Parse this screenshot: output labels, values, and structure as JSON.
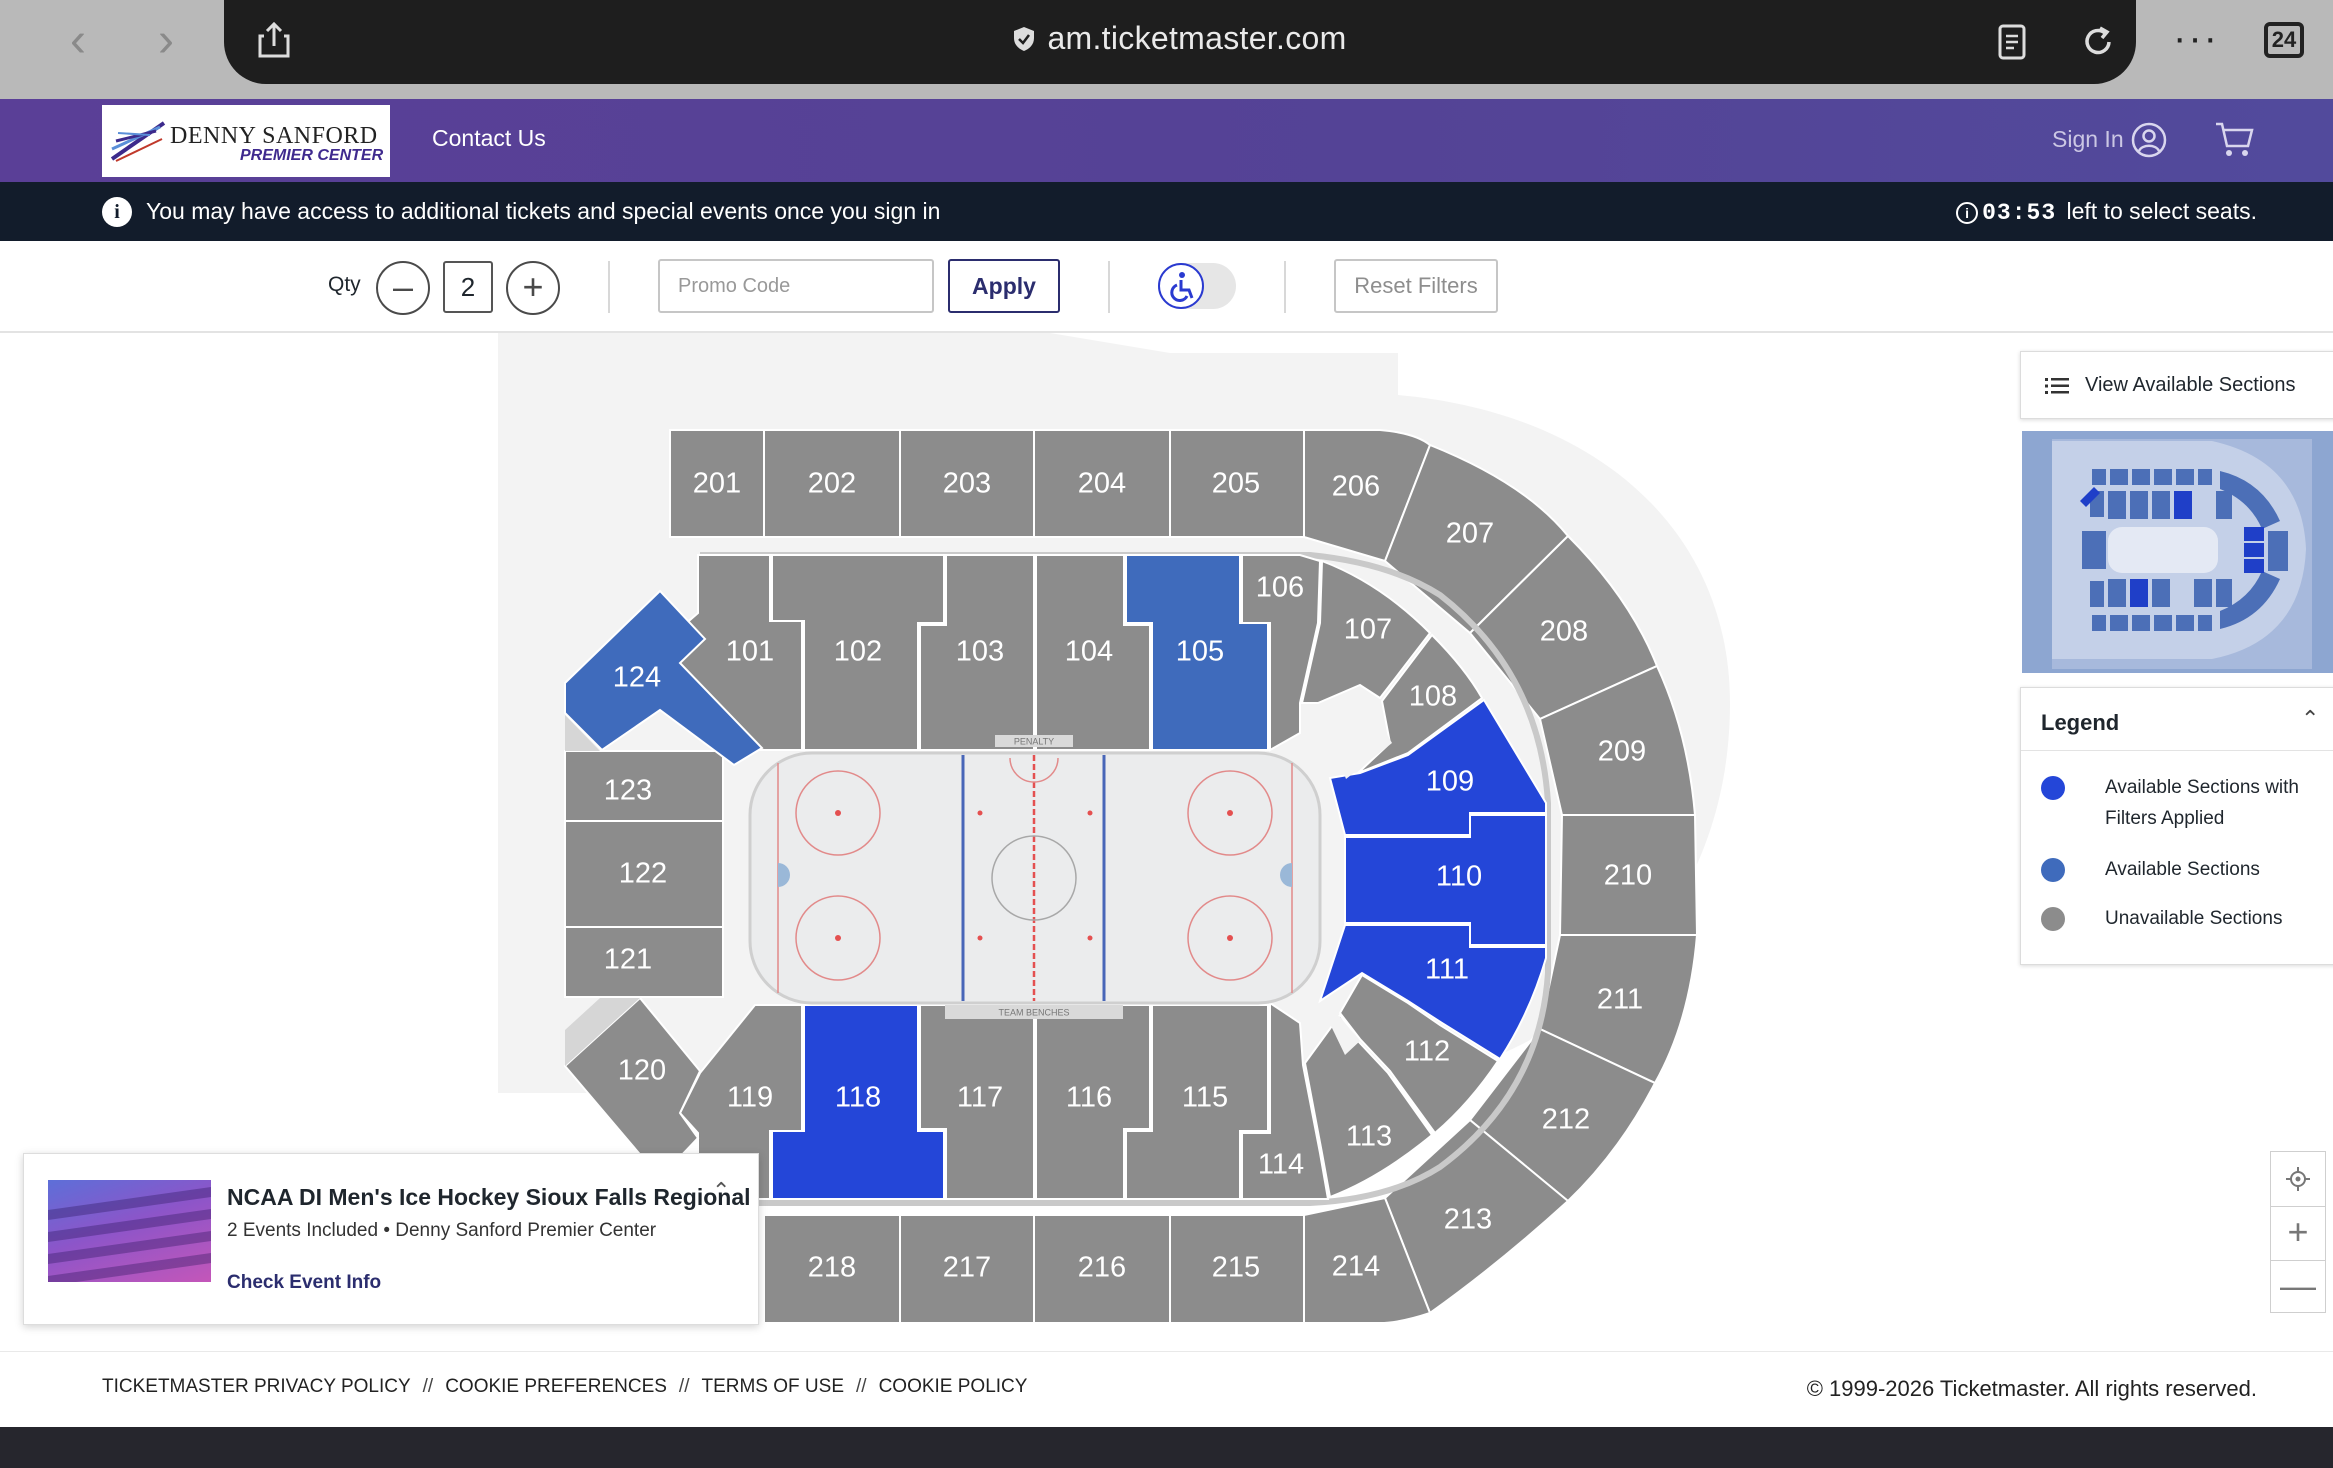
{
  "browser": {
    "url": "am.ticketmaster.com",
    "tab_count": "24",
    "more_label": "···"
  },
  "header": {
    "logo_line1": "DENNY SANFORD",
    "logo_line2": "PREMIER CENTER",
    "contact_us": "Contact Us",
    "sign_in": "Sign In"
  },
  "notice": {
    "message": "You may have access to additional tickets and special events once you sign in",
    "timer": "03:53",
    "timer_suffix": "left to select seats."
  },
  "filters": {
    "qty_label": "Qty",
    "qty_value": "2",
    "promo_placeholder": "Promo Code",
    "apply_label": "Apply",
    "reset_label": "Reset Filters",
    "accessible_only": false
  },
  "map": {
    "view_sections_label": "View Available Sections",
    "rink_label_top": "PENALTY",
    "rink_label_bottom": "TEAM BENCHES",
    "colors": {
      "unavailable": "#8c8c8c",
      "available": "#3f6bbc",
      "filtered": "#2446d8"
    },
    "sections": {
      "s101": "101",
      "s102": "102",
      "s103": "103",
      "s104": "104",
      "s105": "105",
      "s106": "106",
      "s107": "107",
      "s108": "108",
      "s109": "109",
      "s110": "110",
      "s111": "111",
      "s112": "112",
      "s113": "113",
      "s114": "114",
      "s115": "115",
      "s116": "116",
      "s117": "117",
      "s118": "118",
      "s119": "119",
      "s120": "120",
      "s121": "121",
      "s122": "122",
      "s123": "123",
      "s124": "124",
      "s201": "201",
      "s202": "202",
      "s203": "203",
      "s204": "204",
      "s205": "205",
      "s206": "206",
      "s207": "207",
      "s208": "208",
      "s209": "209",
      "s210": "210",
      "s211": "211",
      "s212": "212",
      "s213": "213",
      "s214": "214",
      "s215": "215",
      "s216": "216",
      "s217": "217",
      "s218": "218"
    },
    "available_sections": [
      "105",
      "124"
    ],
    "filtered_sections": [
      "109",
      "110",
      "111",
      "118"
    ]
  },
  "legend": {
    "title": "Legend",
    "items": [
      {
        "label": "Available Sections with Filters Applied",
        "color": "#2446d8"
      },
      {
        "label": "Available Sections",
        "color": "#3f6bbc"
      },
      {
        "label": "Unavailable Sections",
        "color": "#8c8c8c"
      }
    ]
  },
  "event": {
    "title": "NCAA DI Men's Ice Hockey Sioux Falls Regional",
    "events_included": "2 Events Included",
    "venue": "Denny Sanford Premier Center",
    "link": "Check Event Info"
  },
  "footer": {
    "links": [
      "TICKETMASTER PRIVACY POLICY",
      "COOKIE PREFERENCES",
      "TERMS OF USE",
      "COOKIE POLICY"
    ],
    "separator": "//",
    "copyright": "© 1999-2026 Ticketmaster. All rights reserved."
  }
}
